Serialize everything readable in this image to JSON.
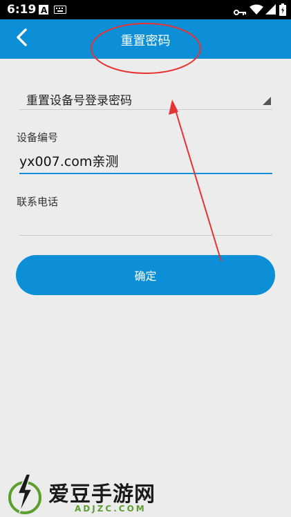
{
  "status_bar": {
    "time": "6:19",
    "left_icons": [
      "a-icon",
      "keyboard-icon"
    ],
    "right_icons": [
      "vpn-key-icon",
      "wifi-icon",
      "signal-icon",
      "battery-icon"
    ]
  },
  "app_bar": {
    "title": "重置密码",
    "back_icon": "chevron-left-icon",
    "color": "#0d8fd8"
  },
  "form": {
    "type_select": {
      "value": "重置设备号登录密码"
    },
    "device_number": {
      "label": "设备编号",
      "value": "yx007.com亲测"
    },
    "phone": {
      "label": "联系电话",
      "value": ""
    },
    "confirm_label": "确定"
  },
  "watermark": {
    "main": "爱豆手游网",
    "sub": "ADJZC.COM"
  },
  "colors": {
    "accent": "#0d8fd8",
    "background": "#ececec",
    "annotation": "#e63232"
  }
}
